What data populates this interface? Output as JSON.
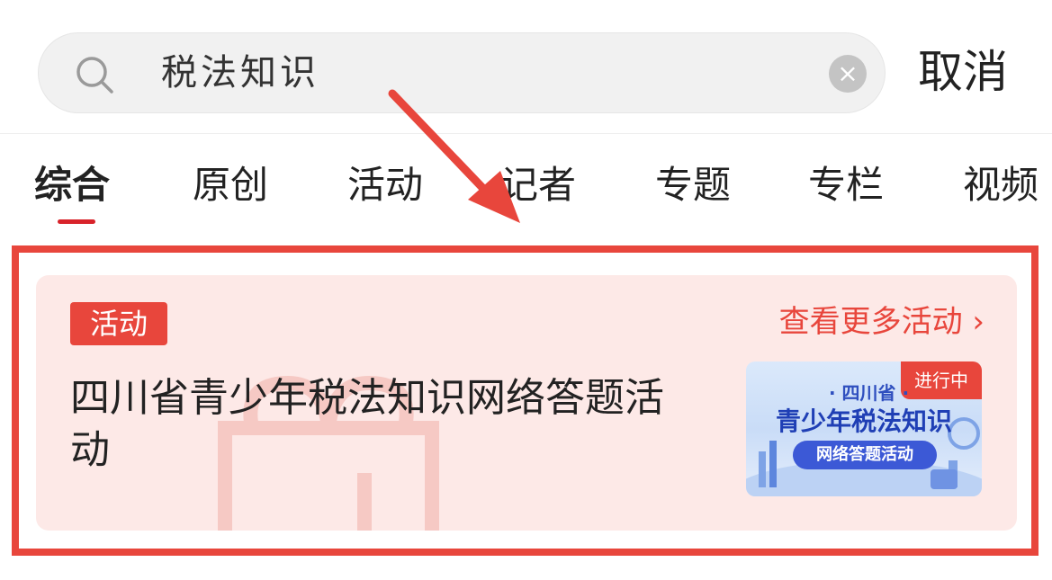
{
  "search": {
    "query": "税法知识",
    "cancel_label": "取消",
    "clear_symbol": "×"
  },
  "tabs": [
    {
      "label": "综合",
      "active": true
    },
    {
      "label": "原创",
      "active": false
    },
    {
      "label": "活动",
      "active": false
    },
    {
      "label": "记者",
      "active": false
    },
    {
      "label": "专题",
      "active": false
    },
    {
      "label": "专栏",
      "active": false
    },
    {
      "label": "视频",
      "active": false
    }
  ],
  "activity_card": {
    "badge": "活动",
    "more_link": "查看更多活动 ›",
    "title": "四川省青少年税法知识网络答题活动",
    "thumbnail": {
      "status": "进行中",
      "province": "· 四川省 ·",
      "headline": "青少年税法知识",
      "pill": "网络答题活动"
    }
  },
  "colors": {
    "accent": "#e8463c",
    "tab_indicator": "#d8232a",
    "card_background": "#fde9e7",
    "search_background": "#f1f1f1"
  },
  "icons": {
    "search": "search-icon",
    "clear": "clear-icon",
    "chevron": "chevron-right-icon"
  }
}
